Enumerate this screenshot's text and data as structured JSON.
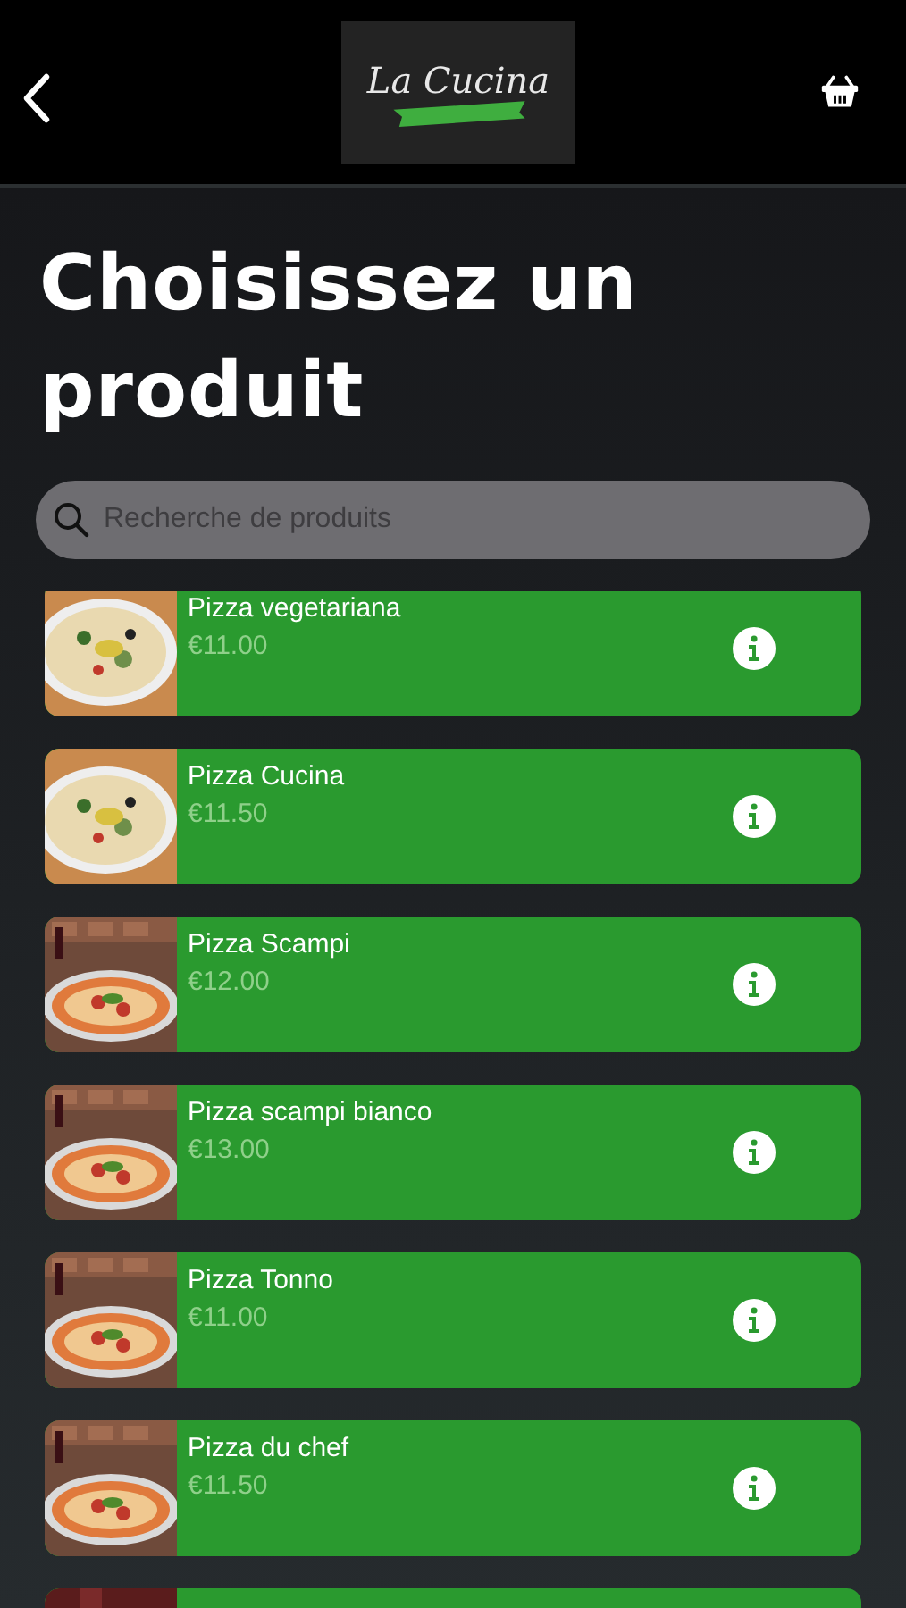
{
  "header": {
    "logo": "La Cucina"
  },
  "title": "Choisissez un produit",
  "search": {
    "placeholder": "Recherche de produits"
  },
  "products": [
    {
      "kind": "product",
      "name": "Pizza vegetariana",
      "price": "€11.00"
    },
    {
      "kind": "product",
      "name": "Pizza Cucina",
      "price": "€11.50"
    },
    {
      "kind": "product",
      "name": "Pizza Scampi",
      "price": "€12.00"
    },
    {
      "kind": "product",
      "name": "Pizza scampi bianco",
      "price": "€13.00"
    },
    {
      "kind": "product",
      "name": "Pizza Tonno",
      "price": "€11.00"
    },
    {
      "kind": "product",
      "name": "Pizza du chef",
      "price": "€11.50"
    },
    {
      "kind": "picture"
    }
  ]
}
